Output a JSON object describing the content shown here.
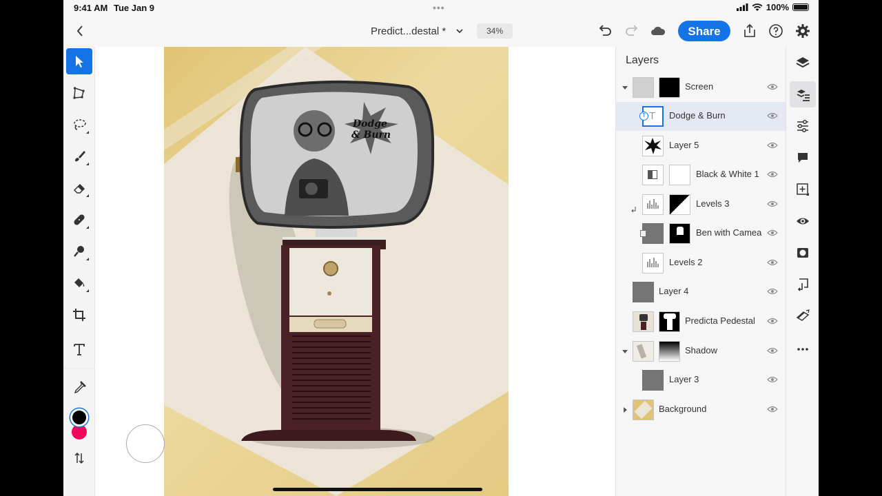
{
  "status_bar": {
    "time": "9:41 AM",
    "date": "Tue Jan 9",
    "battery": "100%"
  },
  "header": {
    "document_name": "Predict...destal *",
    "zoom": "34%",
    "share_label": "Share"
  },
  "canvas": {
    "caption_line1": "Dodge",
    "caption_line2": "& Burn"
  },
  "toolbar": {
    "tools": [
      "select-tool",
      "transform-tool",
      "lasso-tool",
      "brush-tool",
      "eraser-tool",
      "healing-tool",
      "clone-tool",
      "fill-tool",
      "crop-tool",
      "type-tool",
      "eyedropper-tool"
    ],
    "foreground_color": "#000000",
    "background_color": "#f1065c"
  },
  "layers_panel": {
    "title": "Layers",
    "layers": [
      {
        "name": "Screen",
        "type": "group",
        "expanded": true,
        "selected": false
      },
      {
        "name": "Dodge & Burn",
        "type": "text",
        "selected": true
      },
      {
        "name": "Layer 5",
        "type": "pixel",
        "selected": false
      },
      {
        "name": "Black & White 1",
        "type": "adjustment",
        "selected": false
      },
      {
        "name": "Levels 3",
        "type": "adjustment",
        "selected": false
      },
      {
        "name": "Ben with Camea",
        "type": "smart",
        "selected": false
      },
      {
        "name": "Levels 2",
        "type": "adjustment",
        "selected": false
      },
      {
        "name": "Layer 4",
        "type": "pixel",
        "selected": false
      },
      {
        "name": "Predicta Pedestal",
        "type": "pixel",
        "selected": false
      },
      {
        "name": "Shadow",
        "type": "group",
        "expanded": true,
        "selected": false
      },
      {
        "name": "Layer 3",
        "type": "pixel",
        "selected": false
      },
      {
        "name": "Background",
        "type": "group",
        "expanded": false,
        "selected": false
      }
    ]
  },
  "right_rail": {
    "items": [
      "layers-icon",
      "layer-properties-icon",
      "adjustments-icon",
      "comments-icon",
      "add-layer-icon",
      "visibility-icon",
      "mask-icon",
      "arrange-icon",
      "effects-icon",
      "more-icon"
    ]
  },
  "accent_color": "#1473e6"
}
